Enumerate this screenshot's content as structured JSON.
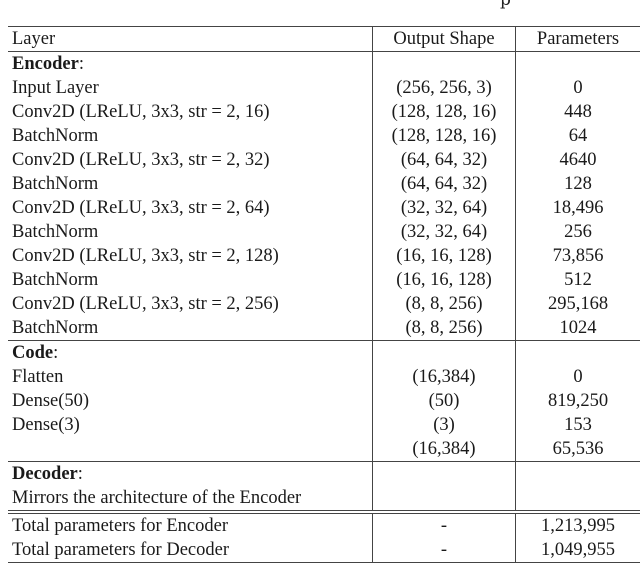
{
  "caption_fragment": "p",
  "table": {
    "headers": [
      "Layer",
      "Output Shape",
      "Parameters"
    ],
    "sections": [
      {
        "title": "Encoder",
        "title_suffix": ":",
        "rows": [
          {
            "layer": "Input Layer",
            "shape": "(256, 256, 3)",
            "params": "0"
          },
          {
            "layer": "Conv2D (LReLU, 3x3, str = 2, 16)",
            "shape": "(128, 128, 16)",
            "params": "448"
          },
          {
            "layer": "BatchNorm",
            "shape": "(128, 128, 16)",
            "params": "64"
          },
          {
            "layer": "Conv2D (LReLU, 3x3, str = 2, 32)",
            "shape": "(64, 64, 32)",
            "params": "4640"
          },
          {
            "layer": "BatchNorm",
            "shape": "(64, 64, 32)",
            "params": "128"
          },
          {
            "layer": "Conv2D (LReLU, 3x3, str = 2, 64)",
            "shape": "(32, 32, 64)",
            "params": "18,496"
          },
          {
            "layer": "BatchNorm",
            "shape": "(32, 32, 64)",
            "params": "256"
          },
          {
            "layer": "Conv2D (LReLU, 3x3, str = 2, 128)",
            "shape": "(16, 16, 128)",
            "params": "73,856"
          },
          {
            "layer": "BatchNorm",
            "shape": "(16, 16, 128)",
            "params": "512"
          },
          {
            "layer": "Conv2D (LReLU, 3x3, str = 2, 256)",
            "shape": "(8, 8, 256)",
            "params": "295,168"
          },
          {
            "layer": "BatchNorm",
            "shape": "(8, 8, 256)",
            "params": "1024"
          }
        ]
      },
      {
        "title": "Code",
        "title_suffix": ":",
        "rows": [
          {
            "layer": "Flatten",
            "shape": "(16,384)",
            "params": "0"
          },
          {
            "layer": "Dense(50)",
            "shape": "(50)",
            "params": "819,250"
          },
          {
            "layer": "Dense(3)",
            "shape": "(3)",
            "params": "153"
          },
          {
            "layer": "",
            "shape": "(16,384)",
            "params": "65,536"
          }
        ]
      },
      {
        "title": "Decoder",
        "title_suffix": ":",
        "rows": [
          {
            "layer": "Mirrors the architecture of the Encoder",
            "shape": "",
            "params": ""
          }
        ]
      }
    ],
    "totals": [
      {
        "label": "Total parameters for Encoder",
        "shape": "-",
        "params": "1,213,995"
      },
      {
        "label": "Total parameters for Decoder",
        "shape": "-",
        "params": "1,049,955"
      }
    ]
  }
}
